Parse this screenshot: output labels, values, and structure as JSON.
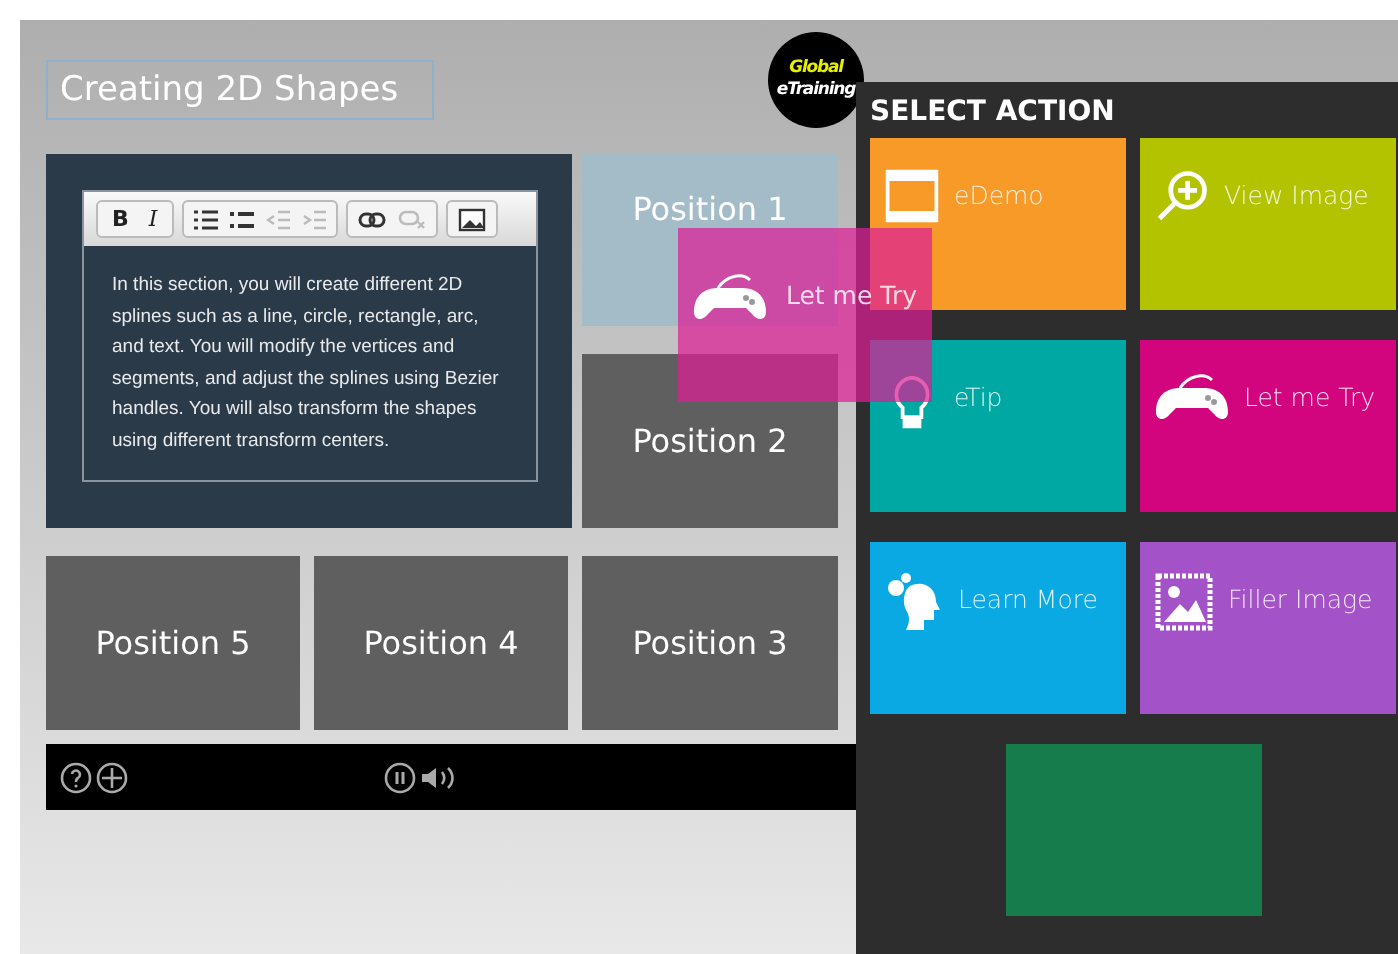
{
  "title": "Creating 2D Shapes",
  "logo": {
    "line1": "Global",
    "line2": "eTraining"
  },
  "editor": {
    "toolbar": [
      {
        "kind": "bold",
        "label": "B"
      },
      {
        "kind": "italic",
        "label": "I"
      }
    ],
    "text": "In this section, you will create different 2D splines such as a line, circle, rectangle, arc, and text. You will modify the vertices and segments, and adjust the splines using Bezier handles. You will also transform the shapes using different transform centers."
  },
  "positions": [
    {
      "label": "Position 1",
      "highlighted": true
    },
    {
      "label": "Position 2",
      "highlighted": false
    },
    {
      "label": "Position 5",
      "highlighted": false
    },
    {
      "label": "Position 4",
      "highlighted": false
    },
    {
      "label": "Position 3",
      "highlighted": false
    }
  ],
  "panel": {
    "title": "SELECT ACTION",
    "actions": [
      {
        "kind": "film",
        "label": "eDemo",
        "color": "#f79a28"
      },
      {
        "kind": "zoom",
        "label": "View Image",
        "color": "#b4c300"
      },
      {
        "kind": "bulb",
        "label": "eTip",
        "color": "#00a8a3"
      },
      {
        "kind": "gamepad",
        "label": "Let me Try",
        "color": "#d2047e"
      },
      {
        "kind": "head",
        "label": "Learn More",
        "color": "#0ba9e3"
      },
      {
        "kind": "image",
        "label": "Filler Image",
        "color": "#a452c8"
      },
      {
        "kind": "blank",
        "color": "#177c4c"
      }
    ]
  },
  "dragged": {
    "kind": "gamepad",
    "label": "Let me Try"
  }
}
